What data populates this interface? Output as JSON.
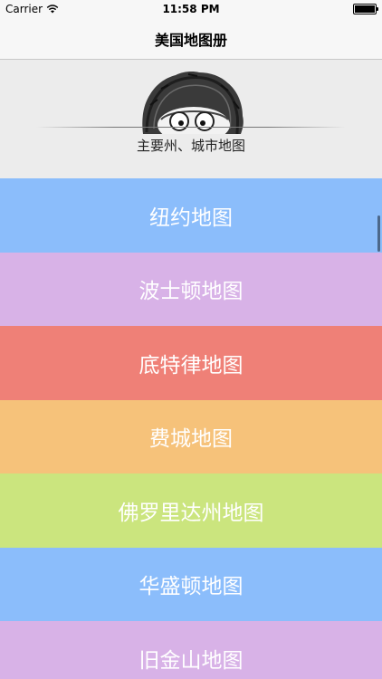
{
  "status_bar": {
    "carrier": "Carrier",
    "time": "11:58 PM",
    "wifi_icon": "wifi-icon",
    "battery_icon": "battery-icon"
  },
  "nav": {
    "title": "美国地图册"
  },
  "header": {
    "caption": "主要州、城市地图",
    "mascot_icon": "cartoon-mascot-peeking"
  },
  "cities": [
    {
      "label": "纽约地图",
      "color": "#8bbdfb"
    },
    {
      "label": "波士顿地图",
      "color": "#d8b2e7"
    },
    {
      "label": "底特律地图",
      "color": "#ef8077"
    },
    {
      "label": "费城地图",
      "color": "#f6c27a"
    },
    {
      "label": "佛罗里达州地图",
      "color": "#cbe57e"
    },
    {
      "label": "华盛顿地图",
      "color": "#8bbdfb"
    },
    {
      "label": "旧金山地图",
      "color": "#d8b2e7"
    }
  ]
}
